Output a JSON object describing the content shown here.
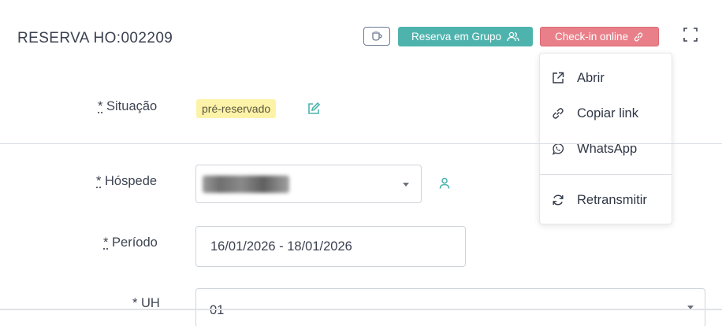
{
  "header": {
    "title": "RESERVA HO:002209",
    "group_button_label": "Reserva em Grupo",
    "checkin_button_label": "Check-in online",
    "colors": {
      "group": "#4fb3ad",
      "checkin": "#e98089"
    }
  },
  "checkin_menu": {
    "items": [
      {
        "label": "Abrir",
        "icon": "external-link-icon"
      },
      {
        "label": "Copiar link",
        "icon": "link-icon"
      },
      {
        "label": "WhatsApp",
        "icon": "whatsapp-icon"
      },
      {
        "label": "Retransmitir",
        "icon": "refresh-icon"
      }
    ]
  },
  "form": {
    "situacao": {
      "required_mark": "*",
      "label": "Situação",
      "badge": "pré-reservado",
      "badge_color": "#fdf3a8"
    },
    "hospede": {
      "required_mark": "*",
      "label": "Hóspede"
    },
    "periodo": {
      "required_mark": "*",
      "label": "Período",
      "value": "16/01/2026 - 18/01/2026"
    },
    "uh": {
      "required_mark": "*",
      "label": "UH",
      "value": "01"
    }
  }
}
